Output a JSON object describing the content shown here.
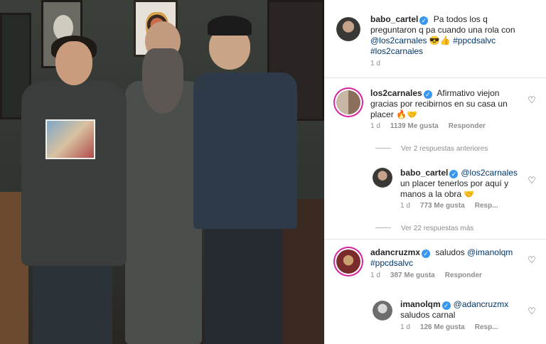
{
  "post": {
    "author": "babo_cartel",
    "caption_parts": [
      "Pa todos los q preguntaron q pa cuando una rola con ",
      "@los2carnales",
      " 😎👍 ",
      "#ppcdsalvc",
      " ",
      "#los2carnales"
    ],
    "age": "1 d"
  },
  "comments": [
    {
      "user": "los2carnales",
      "text": "Afirmativo viejon gracias por recibirnos en su casa un placer 🔥🤝",
      "age": "1 d",
      "likes": "1139 Me gusta",
      "reply_label": "Responder"
    },
    {
      "user": "babo_cartel",
      "mention": "@los2carnales",
      "text": " un placer tenerlos por aquí y manos a la obra 🤝",
      "age": "1 d",
      "likes": "773 Me gusta",
      "reply_label": "Resp..."
    },
    {
      "user": "adancruzmx",
      "text_prefix": "saludos ",
      "mention": "@imanolqm",
      "tag": "#ppcdsalvc",
      "age": "1 d",
      "likes": "387 Me gusta",
      "reply_label": "Responder"
    },
    {
      "user": "imanolqm",
      "mention": "@adancruzmx",
      "text": "saludos carnal",
      "age": "1 d",
      "likes": "126 Me gusta",
      "reply_label": "Resp..."
    }
  ],
  "view_replies_prev": "Ver 2 respuestas anteriores",
  "view_replies_more": "Ver 22 respuestas más",
  "colors": {
    "verified": "#3897f0",
    "link": "#00376b",
    "meta": "#8e8e8e",
    "ring": "#d6249f"
  },
  "icons": {
    "verified": "check-badge-icon",
    "like": "heart-outline-icon"
  }
}
